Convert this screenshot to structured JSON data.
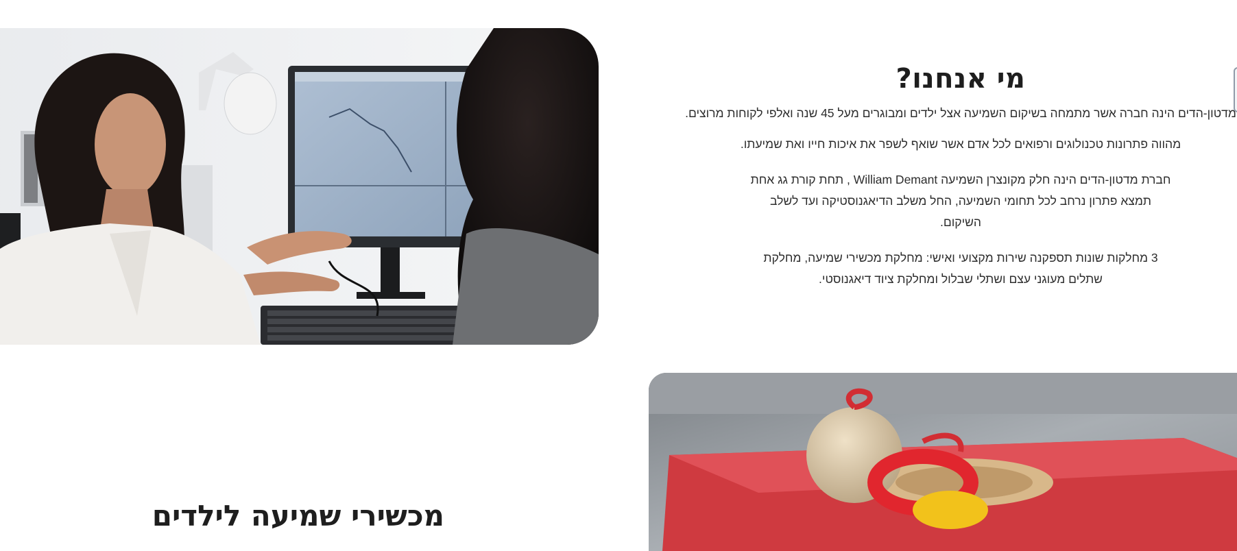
{
  "about": {
    "title": "מי אנחנו?",
    "paragraphs": [
      "מדטון-הדים הינה חברה אשר מתמחה בשיקום השמיעה אצל ילדים ומבוגרים מעל 45 שנה ואלפי לקוחות מרוצים.",
      "מהווה פתרונות טכנולוגים ורפואים לכל אדם אשר שואף לשפר את איכות חייו ואת שמיעתו.",
      "חברת מדטון-הדים הינה חלק מקונצרן השמיעה William Demant , תחת קורת גג אחת תמצא פתרון נרחב לכל תחומי השמיעה, החל משלב הדיאגנוסטיקה ועד לשלב השיקום.",
      "3 מחלקות שונות תספקנה שירות מקצועי ואישי: מחלקת מכשירי שמיעה, מחלקת שתלים מעוגני עצם ושתלי שבלול ומחלקת ציוד דיאגנוסטי."
    ]
  },
  "kids_section": {
    "title": "מכשירי שמיעה לילדים"
  },
  "images": {
    "top": "audiologist-consultation-photo",
    "bottom": "child-toy-photo"
  },
  "colors": {
    "heading": "#1e1e1e",
    "body_text": "#2d2d2d",
    "toy_red": "#d8323a",
    "toy_yellow": "#f2c21b"
  }
}
